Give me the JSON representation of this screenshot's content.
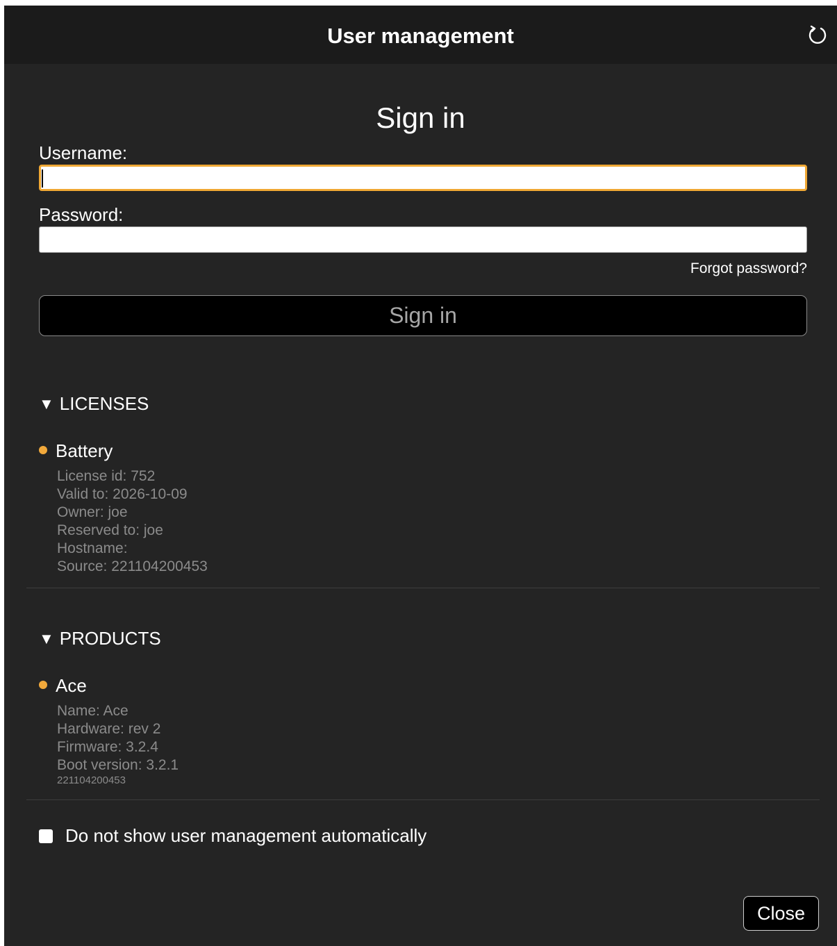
{
  "window": {
    "title": "User management",
    "refresh_icon": "refresh-icon"
  },
  "signin": {
    "heading": "Sign in",
    "username_label": "Username:",
    "username_value": "",
    "password_label": "Password:",
    "password_value": "",
    "forgot_label": "Forgot password?",
    "button_label": "Sign in"
  },
  "licenses": {
    "header": "LICENSES",
    "toggle_icon": "triangle-down-icon",
    "items": [
      {
        "name": "Battery",
        "status_color": "#f2a93b",
        "details": [
          "License id: 752",
          "Valid to: 2026-10-09",
          "Owner: joe",
          "Reserved to: joe",
          "Hostname:",
          "Source: 221104200453"
        ]
      }
    ]
  },
  "products": {
    "header": "PRODUCTS",
    "toggle_icon": "triangle-down-icon",
    "items": [
      {
        "name": "Ace",
        "status_color": "#f2a93b",
        "details": [
          "Name: Ace",
          "Hardware: rev 2",
          "Firmware: 3.2.4",
          "Boot version: 3.2.1"
        ],
        "serial": "221104200453"
      }
    ]
  },
  "footer": {
    "checkbox_label": "Do not show user management automatically",
    "checkbox_checked": false,
    "close_label": "Close"
  },
  "colors": {
    "accent": "#f0a834",
    "background": "#242424",
    "titlebar": "#1b1b1b"
  }
}
